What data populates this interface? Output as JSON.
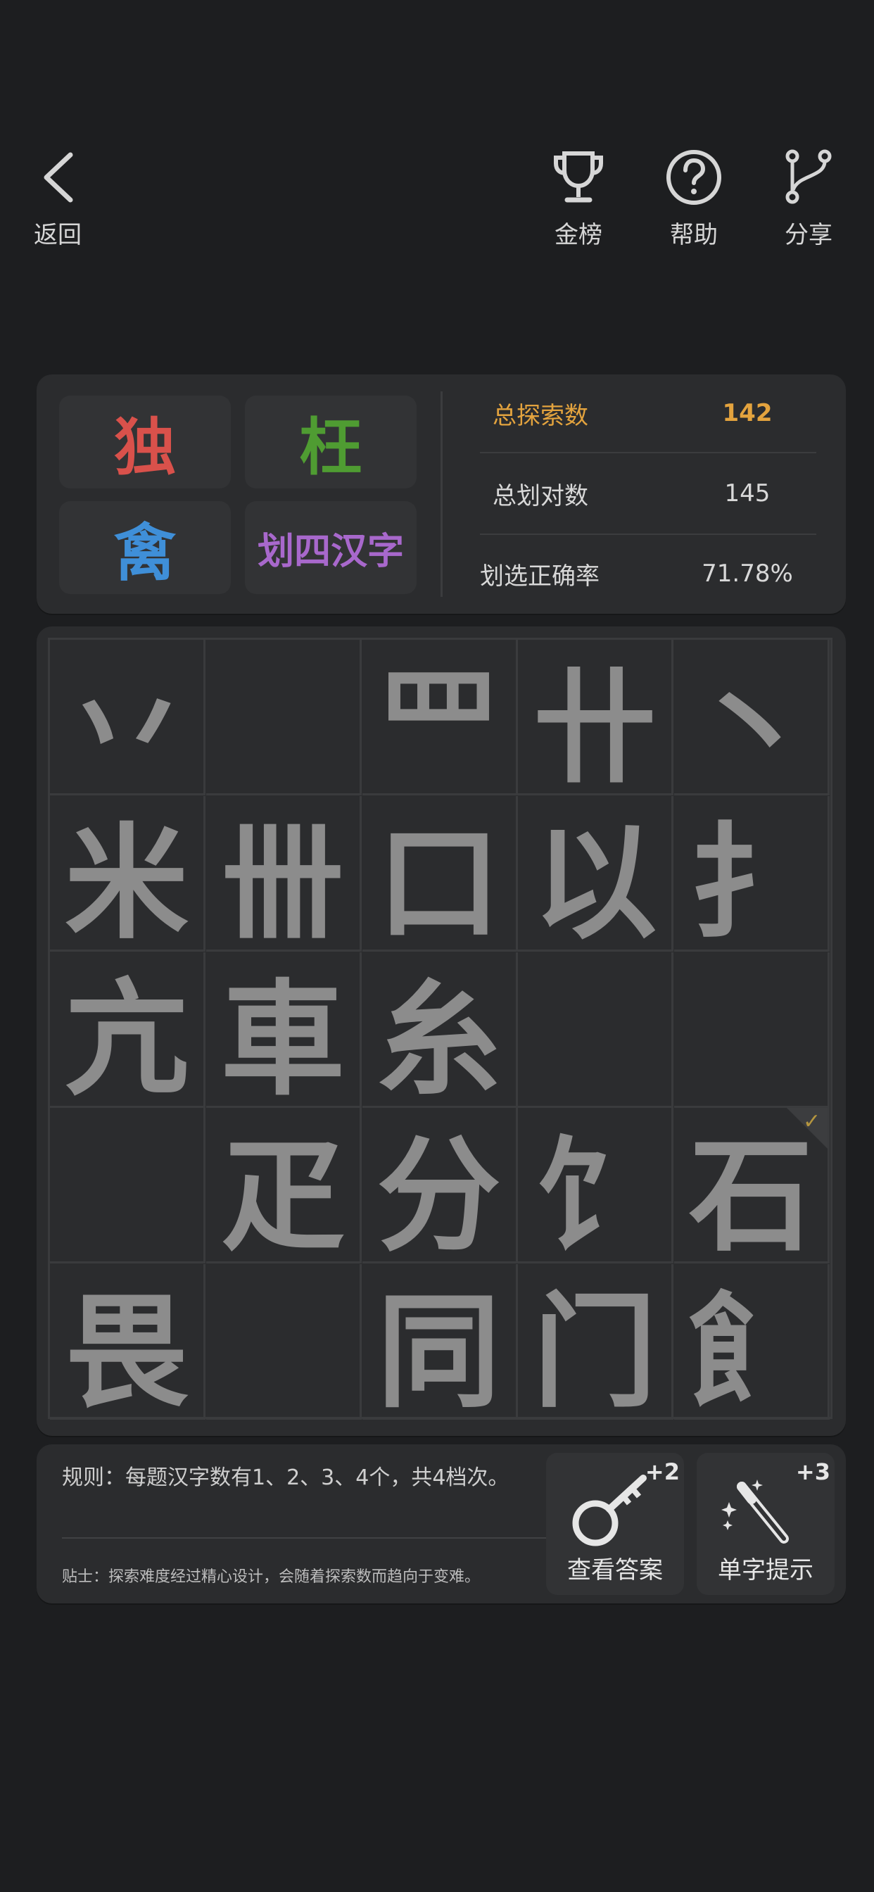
{
  "nav": {
    "back_label": "返回",
    "leaderboard_label": "金榜",
    "help_label": "帮助",
    "share_label": "分享"
  },
  "header_tiles": [
    {
      "text": "独",
      "color": "#d9514b"
    },
    {
      "text": "枉",
      "color": "#4f9c32"
    },
    {
      "text": "禽",
      "color": "#3f8fd8"
    },
    {
      "text": "划四汉字",
      "color": "#a868cc"
    }
  ],
  "stats": {
    "total_explored_label": "总探索数",
    "total_explored_value": "142",
    "total_correct_label": "总划对数",
    "total_correct_value": "145",
    "accuracy_label": "划选正确率",
    "accuracy_value": "71.78%",
    "highlight_color": "#e3a33e"
  },
  "grid": {
    "rows": [
      [
        "丷",
        "",
        "罒",
        "卄",
        "丶"
      ],
      [
        "米",
        "卌",
        "口",
        "以",
        "扌"
      ],
      [
        "亢",
        "車",
        "糸",
        "",
        ""
      ],
      [
        "",
        "疋",
        "分",
        "饣",
        "石"
      ],
      [
        "畏",
        "",
        "同",
        "门",
        "飠"
      ]
    ]
  },
  "bottom": {
    "rule_text": "规则：每题汉字数有1、2、3、4个，共4档次。",
    "tip_text": "贴士：探索难度经过精心设计，会随着探索数而趋向于变难。",
    "answer_button_label": "查看答案",
    "answer_button_cost": "+2",
    "hint_button_label": "单字提示",
    "hint_button_cost": "+3"
  }
}
